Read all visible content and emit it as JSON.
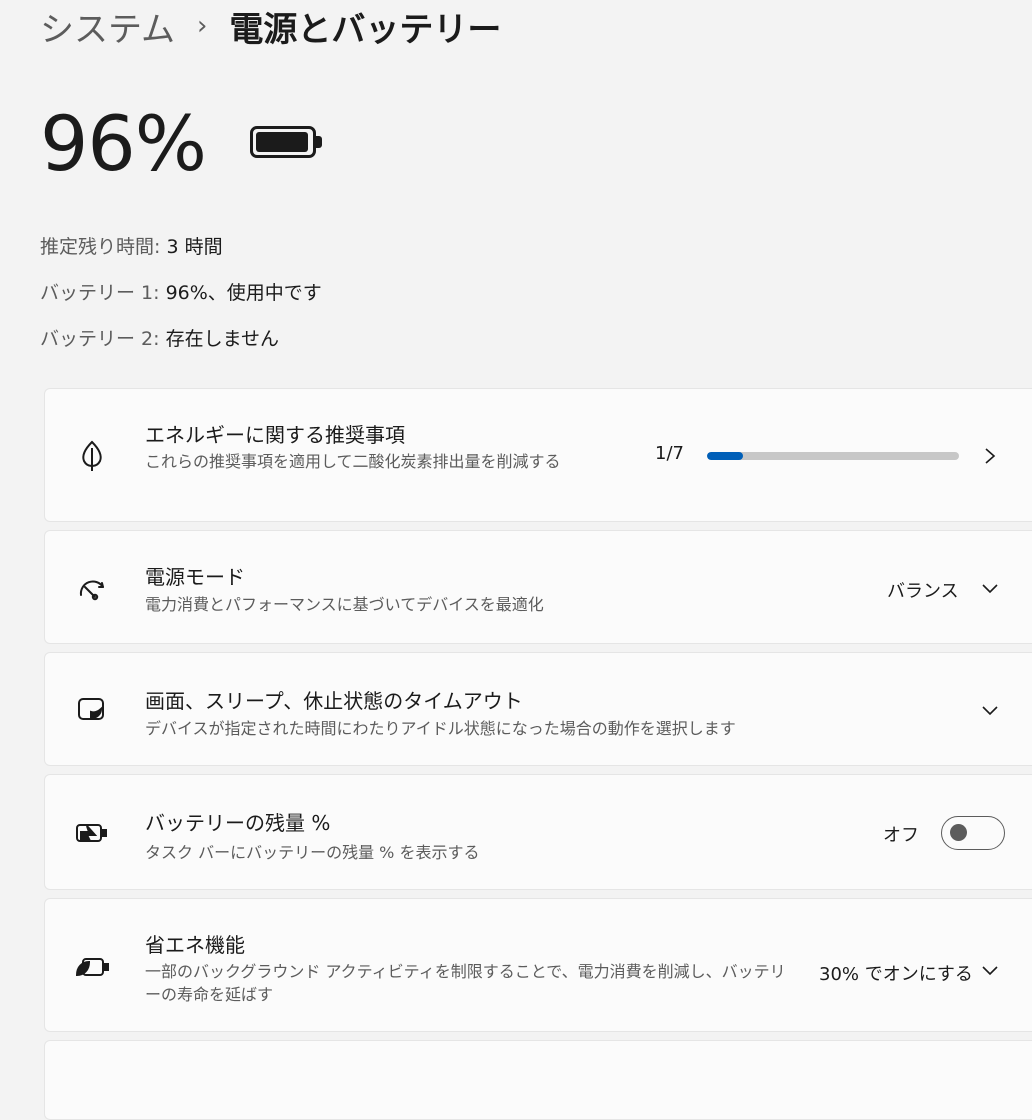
{
  "breadcrumb": {
    "parent": "システム",
    "separator": "›",
    "current": "電源とバッテリー"
  },
  "battery": {
    "percent_text": "96%",
    "level": 0.96
  },
  "info": {
    "remaining_label": "推定残り時間:",
    "remaining_value": "3 時間",
    "battery1_label": "バッテリー 1:",
    "battery1_value": "96%、使用中です",
    "battery2_label": "バッテリー 2:",
    "battery2_value": "存在しません"
  },
  "cards": {
    "energy": {
      "icon": "leaf-icon",
      "title": "エネルギーに関する推奨事項",
      "desc": "これらの推奨事項を適用して二酸化炭素排出量を削減する",
      "progress_text": "1/7",
      "progress": 0.143
    },
    "power_mode": {
      "icon": "speedometer-icon",
      "title": "電源モード",
      "desc": "電力消費とパフォーマンスに基づいてデバイスを最適化",
      "value": "バランス"
    },
    "timeout": {
      "icon": "screen-sleep-icon",
      "title": "画面、スリープ、休止状態のタイムアウト",
      "desc": "デバイスが指定された時間にわたりアイドル状態になった場合の動作を選択します"
    },
    "battery_pct": {
      "icon": "battery-charging-icon",
      "title": "バッテリーの残量 %",
      "desc": "タスク バーにバッテリーの残量 % を表示する",
      "value": "オフ",
      "toggle_on": false
    },
    "saver": {
      "icon": "battery-saver-icon",
      "title": "省エネ機能",
      "desc": "一部のバックグラウンド アクティビティを制限することで、電力消費を削減し、バッテリーの寿命を延ばす",
      "value": "30% でオンにする"
    }
  },
  "colors": {
    "accent": "#005fb8",
    "background": "#f3f3f3",
    "card": "#fbfbfb"
  }
}
